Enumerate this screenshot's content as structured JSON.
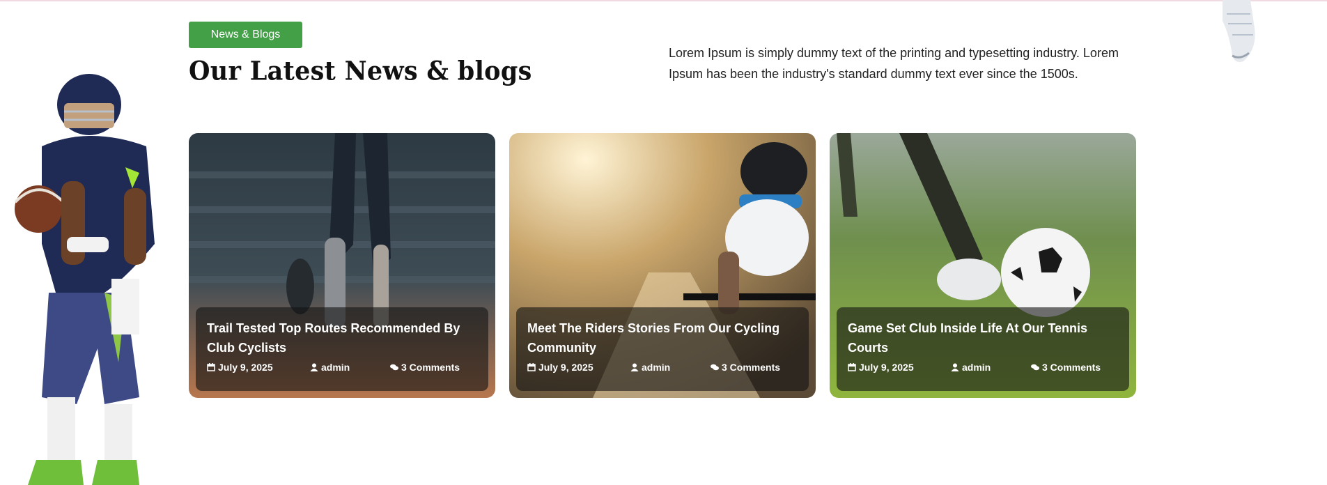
{
  "section": {
    "badge": "News & Blogs",
    "title": "Our Latest News & blogs",
    "description": "Lorem Ipsum is simply dummy text of the printing and typesetting industry. Lorem Ipsum has been the industry's standard dummy text ever since the 1500s."
  },
  "posts": [
    {
      "title": "Trail Tested Top Routes Recommended By Club Cyclists",
      "date": "July 9, 2025",
      "author": "admin",
      "comments": "3 Comments",
      "image": "stadium-track-runner-photo"
    },
    {
      "title": "Meet The Riders Stories From Our Cycling Community",
      "date": "July 9, 2025",
      "author": "admin",
      "comments": "3 Comments",
      "image": "road-cyclist-photo"
    },
    {
      "title": "Game Set Club Inside Life At Our Tennis Courts",
      "date": "July 9, 2025",
      "author": "admin",
      "comments": "3 Comments",
      "image": "soccer-ball-on-grass-photo"
    }
  ],
  "icons": {
    "date": "calendar-icon",
    "author": "user-icon",
    "comments": "comments-icon"
  },
  "colors": {
    "accent": "#43a047",
    "heading": "#111111",
    "card_overlay": "#121212"
  }
}
